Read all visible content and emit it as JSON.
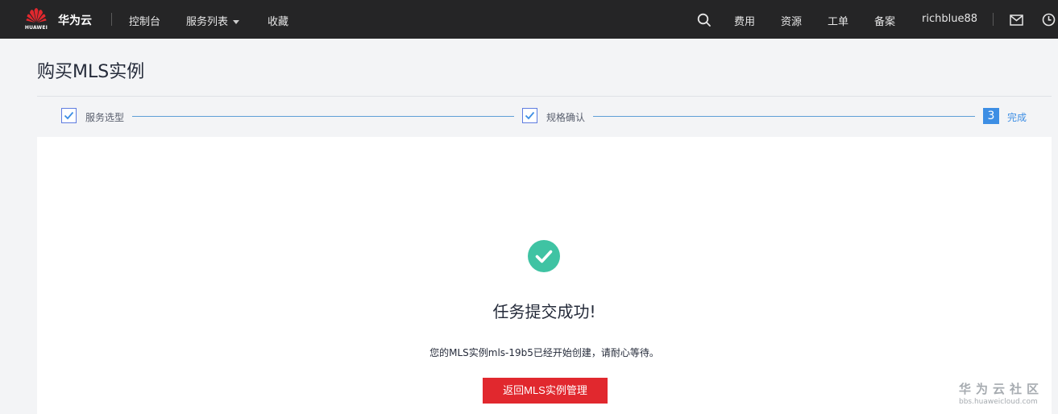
{
  "topbar": {
    "logo_text": "HUAWEI",
    "brand": "华为云",
    "nav": {
      "console": "控制台",
      "service_list": "服务列表",
      "favorites": "收藏"
    },
    "right": {
      "fees": "费用",
      "resources": "资源",
      "tickets": "工单",
      "filing": "备案",
      "username": "richblue88"
    },
    "colors": {
      "bg": "#252526",
      "logo": "#e1282e"
    }
  },
  "page": {
    "title": "购买MLS实例"
  },
  "steps": [
    {
      "label": "服务选型",
      "state": "done"
    },
    {
      "label": "规格确认",
      "state": "done"
    },
    {
      "label": "完成",
      "number": "3",
      "state": "active"
    }
  ],
  "result": {
    "title": "任务提交成功!",
    "description": "您的MLS实例mls-19b5已经开始创建，请耐心等待。",
    "button_label": "返回MLS实例管理",
    "icon": "check-circle-icon",
    "colors": {
      "success": "#3fc3a3",
      "button": "#e1282e"
    }
  },
  "watermark": {
    "name": "华为云社区",
    "url": "bbs.huaweicloud.com"
  }
}
